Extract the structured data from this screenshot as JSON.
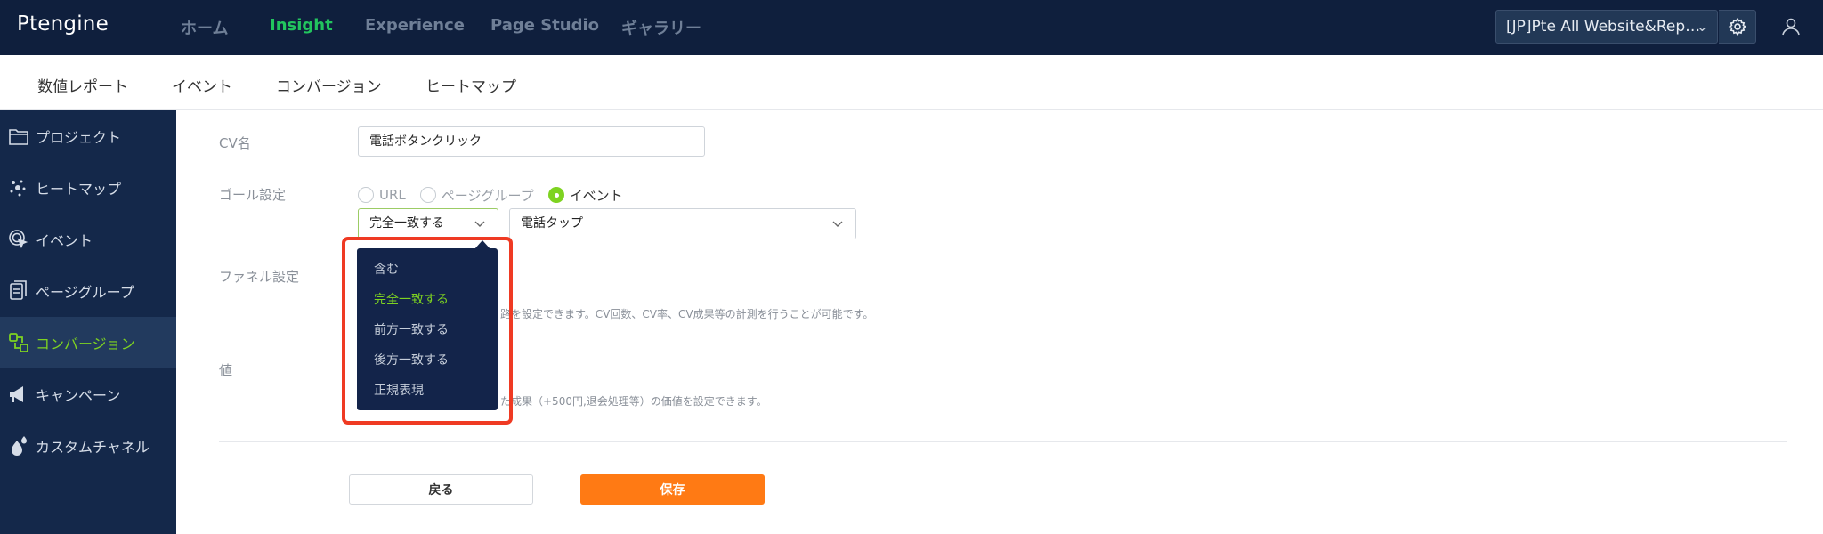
{
  "brand": {
    "logo": "Ptengine",
    "accent": "#22c55e",
    "sidebar_active": "#7ed321",
    "save_color": "#ff7a14",
    "highlight_color": "#ef3a23"
  },
  "topnav": {
    "items": [
      {
        "label": "ホーム"
      },
      {
        "label": "Insight"
      },
      {
        "label": "Experience"
      },
      {
        "label": "Page Studio"
      },
      {
        "label": "ギャラリー"
      }
    ],
    "active": "Insight",
    "site_select": "[JP]Pte All Website&Rep…",
    "icons": [
      "gear-icon",
      "user-icon"
    ]
  },
  "subnav": {
    "items": [
      {
        "label": "数値レポート"
      },
      {
        "label": "イベント"
      },
      {
        "label": "コンバージョン"
      },
      {
        "label": "ヒートマップ"
      }
    ]
  },
  "sidebar": {
    "items": [
      {
        "label": "プロジェクト",
        "icon": "folder-icon"
      },
      {
        "label": "ヒートマップ",
        "icon": "heatmap-dots-icon"
      },
      {
        "label": "イベント",
        "icon": "click-target-icon"
      },
      {
        "label": "ページグループ",
        "icon": "pages-icon"
      },
      {
        "label": "コンバージョン",
        "icon": "conversion-icon"
      },
      {
        "label": "キャンペーン",
        "icon": "megaphone-icon"
      },
      {
        "label": "カスタムチャネル",
        "icon": "drops-icon"
      }
    ],
    "active": "コンバージョン"
  },
  "form": {
    "cv_name_label": "CV名",
    "cv_name_value": "電話ボタンクリック",
    "goal_label": "ゴール設定",
    "goal_options": [
      "URL",
      "ページグループ",
      "イベント"
    ],
    "goal_selected": "イベント",
    "match_select": "完全一致する",
    "event_select": "電話タップ",
    "funnel_label": "ファネル設定",
    "funnel_hint": "路を設定できます。CV回数、CV率、CV成果等の計測を行うことが可能です。",
    "value_label": "値",
    "value_hint": "た成果（+500円,退会処理等）の価値を設定できます。"
  },
  "dropdown": {
    "options": [
      "含む",
      "完全一致する",
      "前方一致する",
      "後方一致する",
      "正規表現"
    ],
    "selected": "完全一致する"
  },
  "actions": {
    "back_label": "戻る",
    "save_label": "保存"
  }
}
